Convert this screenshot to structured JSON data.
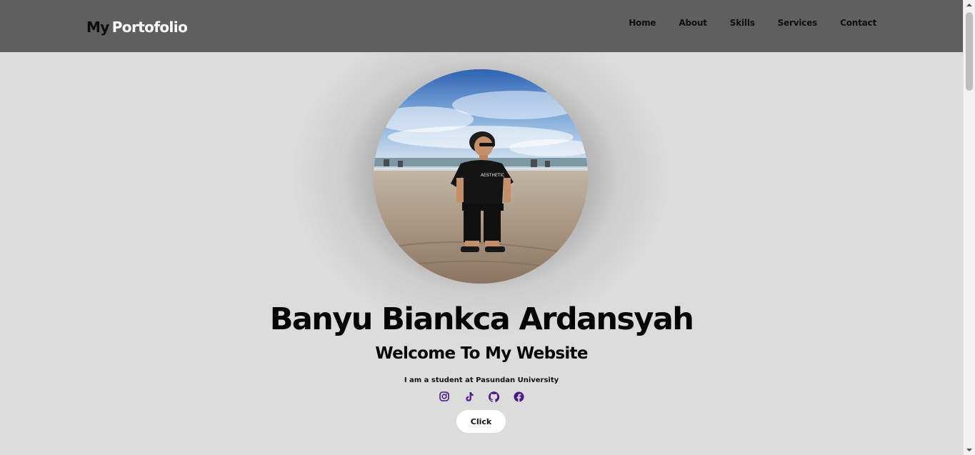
{
  "header": {
    "brand_first": "My",
    "brand_rest": "Portofolio",
    "nav": [
      {
        "label": "Home"
      },
      {
        "label": "About"
      },
      {
        "label": "Skills"
      },
      {
        "label": "Services"
      },
      {
        "label": "Contact"
      }
    ]
  },
  "hero": {
    "name": "Banyu Biankca Ardansyah",
    "welcome": "Welcome To My Website",
    "tagline": "I am a student at Pasundan University",
    "button_label": "Click",
    "socials": [
      {
        "icon": "instagram-icon"
      },
      {
        "icon": "tiktok-icon"
      },
      {
        "icon": "github-icon"
      },
      {
        "icon": "facebook-icon"
      }
    ]
  },
  "colors": {
    "header_bg": "#5f5f5f",
    "page_bg": "#dcdcdc",
    "social_icon": "#4b1a86",
    "button_bg": "#ffffff"
  }
}
